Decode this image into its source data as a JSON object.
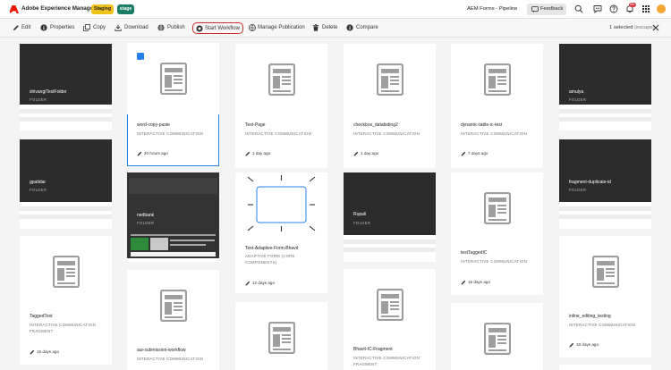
{
  "header": {
    "app_title": "Adobe Experience Manager",
    "badge_staging": "Staging",
    "badge_stage": "stage",
    "tenant": "AEM Forms - Pipeline",
    "feedback": "Feedback",
    "notification_count": "99+",
    "colors": {
      "brand": "#eb1000",
      "staging": "#f1c21b",
      "stage": "#1a7d66",
      "selection": "#2680eb",
      "highlight": "#d0302b"
    }
  },
  "actions": {
    "edit": "Edit",
    "properties": "Properties",
    "copy": "Copy",
    "download": "Download",
    "publish": "Publish",
    "start_workflow": "Start Workflow",
    "manage_publication": "Manage Publication",
    "delete": "Delete",
    "compare": "Compare",
    "selected_count": "1 selected",
    "selected_escape": "(escape)"
  },
  "cards": [
    {
      "title": "shivangiTestFolder",
      "type": "FOLDER",
      "time": ""
    },
    {
      "title": "word-copy-paste",
      "type": "INTERACTIVE COMMUNICATION",
      "time": "20 hours ago",
      "selected": true
    },
    {
      "title": "Test-Page",
      "type": "INTERACTIVE COMMUNICATION",
      "time": "1 day ago"
    },
    {
      "title": "checkbox_databiding2",
      "type": "INTERACTIVE COMMUNICATION",
      "time": "1 day ago"
    },
    {
      "title": "dynamic-table-ic-test",
      "type": "INTERACTIVE COMMUNICATION",
      "time": "7 days ago"
    },
    {
      "title": "amulya",
      "type": "FOLDER",
      "time": ""
    },
    {
      "title": "gpatidar",
      "type": "FOLDER",
      "time": ""
    },
    {
      "title": "nedbank",
      "type": "FOLDER",
      "time": ""
    },
    {
      "title": "Test-Adaptive-Form-Bhavit",
      "type": "ADAPTIVE FORM (CORE COMPONENTS)",
      "time": "12 days ago"
    },
    {
      "title": "Rupali",
      "type": "FOLDER",
      "time": ""
    },
    {
      "title": "testTaggedIC",
      "type": "INTERACTIVE COMMUNICATION",
      "time": "15 days ago"
    },
    {
      "title": "fragment-duplicate-id",
      "type": "FOLDER",
      "time": ""
    },
    {
      "title": "TaggedTest",
      "type": "INTERACTIVE COMMUNICATION FRAGMENT",
      "time": "15 days ago"
    },
    {
      "title": "aui-submission-workflow",
      "type": "INTERACTIVE COMMUNICATION",
      "time": ""
    },
    {
      "title": "Bhavit-IC-Fragment",
      "type": "INTERACTIVE COMMUNICATION FRAGMENT",
      "time": ""
    },
    {
      "title": "inline_editing_testing",
      "type": "INTERACTIVE COMMUNICATION",
      "time": "19 days ago"
    }
  ]
}
